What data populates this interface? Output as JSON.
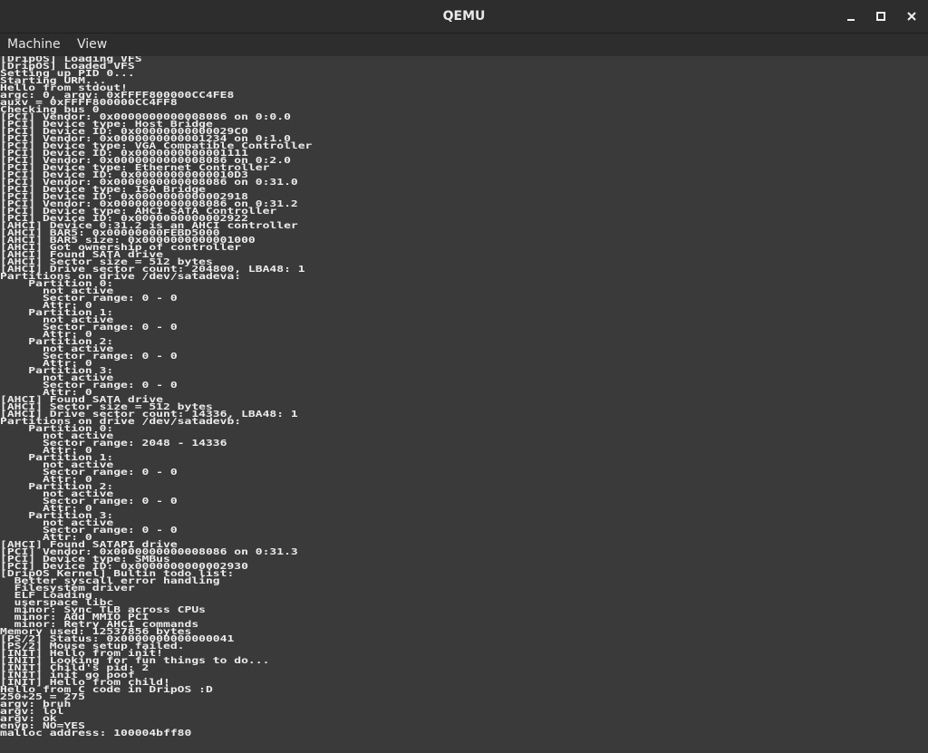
{
  "window": {
    "title": "QEMU"
  },
  "titlebar_buttons": {
    "minimize_icon": "minimize-icon",
    "maximize_icon": "maximize-icon",
    "close_icon": "close-icon"
  },
  "menubar": {
    "items": [
      {
        "label": "Machine"
      },
      {
        "label": "View"
      }
    ]
  },
  "console": {
    "lines": [
      "[DripOS] Loading VFS",
      "[DripOS] Loaded VFS",
      "Setting up PID 0...",
      "Starting URM...",
      "Hello from stdout!",
      "argc: 0, argv: 0xFFFF800000CC4FE8",
      "auxv = 0xFFFF800000CC4FF8",
      "Checking bus 0",
      "[PCI] Vendor: 0x0000000000008086 on 0:0.0",
      "[PCI] Device type: Host Bridge",
      "[PCI] Device ID: 0x00000000000029C0",
      "[PCI] Vendor: 0x0000000000001234 on 0:1.0",
      "[PCI] Device type: VGA Compatible Controller",
      "[PCI] Device ID: 0x0000000000001111",
      "[PCI] Vendor: 0x0000000000008086 on 0:2.0",
      "[PCI] Device type: Ethernet Controller",
      "[PCI] Device ID: 0x00000000000010D3",
      "[PCI] Vendor: 0x0000000000008086 on 0:31.0",
      "[PCI] Device type: ISA Bridge",
      "[PCI] Device ID: 0x0000000000002918",
      "[PCI] Vendor: 0x0000000000008086 on 0:31.2",
      "[PCI] Device type: AHCI SATA Controller",
      "[PCI] Device ID: 0x0000000000002922",
      "[AHCI] Device 0:31.2 is an AHCI controller",
      "[AHCI] BAR5: 0x00000000FEBD5000",
      "[AHCI] BAR5 size: 0x0000000000001000",
      "[AHCI] Got ownership of controller",
      "[AHCI] Found SATA drive",
      "[AHCI] Sector size = 512 bytes",
      "[AHCI] Drive sector count: 204800, LBA48: 1",
      "Partitions on drive /dev/satadeva:",
      "    Partition 0:",
      "      not active",
      "      Sector range: 0 - 0",
      "      Attr: 0",
      "    Partition 1:",
      "      not active",
      "      Sector range: 0 - 0",
      "      Attr: 0",
      "    Partition 2:",
      "      not active",
      "      Sector range: 0 - 0",
      "      Attr: 0",
      "    Partition 3:",
      "      not active",
      "      Sector range: 0 - 0",
      "      Attr: 0",
      "[AHCI] Found SATA drive",
      "[AHCI] Sector size = 512 bytes",
      "[AHCI] Drive sector count: 14336, LBA48: 1",
      "Partitions on drive /dev/satadevb:",
      "    Partition 0:",
      "      not active",
      "      Sector range: 2048 - 14336",
      "      Attr: 0",
      "    Partition 1:",
      "      not active",
      "      Sector range: 0 - 0",
      "      Attr: 0",
      "    Partition 2:",
      "      not active",
      "      Sector range: 0 - 0",
      "      Attr: 0",
      "    Partition 3:",
      "      not active",
      "      Sector range: 0 - 0",
      "      Attr: 0",
      "[AHCI] Found SATAPI drive",
      "[PCI] Vendor: 0x0000000000008086 on 0:31.3",
      "[PCI] Device type: SMBus",
      "[PCI] Device ID: 0x0000000000002930",
      "[DripOS Kernel] Bultin todo list:",
      "  Better syscall error handling",
      "  Filesystem driver",
      "  ELF Loading",
      "  userspace libc",
      "  minor: Sync TLB across CPUs",
      "  minor: Add MMIO PCI",
      "  minor: Retry AHCI commands",
      "Memory used: 12537856 bytes",
      "[PS/2] Status: 0x0000000000000041",
      "[PS/2] Mouse setup failed.",
      "[INIT] Hello from init!",
      "[INIT] Looking for fun things to do...",
      "[INIT] Child's pid: 2",
      "[INIT] init go poof",
      "[INIT] Hello from child!",
      "Hello from C code in DripOS :D",
      "250+25 = 275",
      "argv: bruh",
      "argv: lol",
      "argv: ok",
      "envp: NO=YES",
      "malloc address: 100004bff80"
    ]
  }
}
